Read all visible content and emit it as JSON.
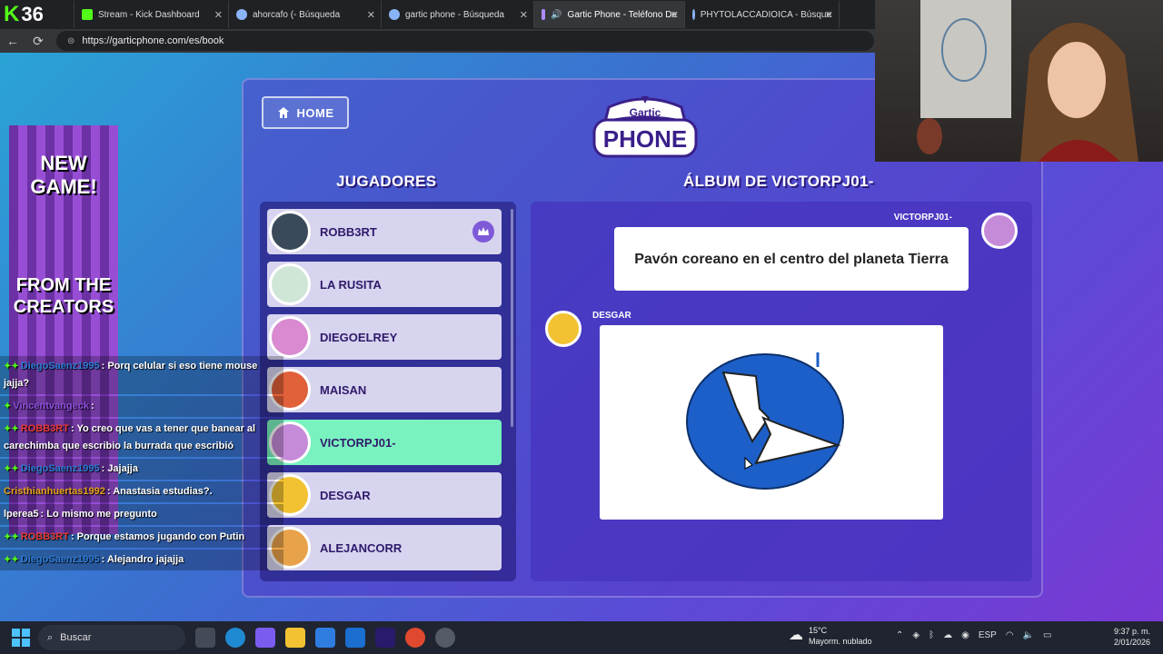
{
  "browser": {
    "kick_viewers": "36",
    "tabs": [
      {
        "label": "Stream - Kick Dashboard",
        "icon_color": "#53fc18"
      },
      {
        "label": "ahorcafo (- Búsqueda",
        "icon_color": "#8ab4f8"
      },
      {
        "label": "gartic phone - Búsqueda",
        "icon_color": "#8ab4f8"
      },
      {
        "label": "Gartic Phone - Teléfono De",
        "icon_color": "#b18cff"
      },
      {
        "label": "PHYTOLACCADIOICA - Búsque",
        "icon_color": "#8ab4f8"
      }
    ],
    "url": "https://garticphone.com/es/book"
  },
  "game": {
    "home_label": "HOME",
    "logo_top": "Gartic",
    "logo_bottom": "PHONE",
    "players_title": "JUGADORES",
    "album_title": "ÁLBUM DE VICTORPJ01-",
    "players": [
      {
        "name": "ROBB3RT",
        "avatar_color": "#3a4a5a",
        "host": true,
        "active": false
      },
      {
        "name": "LA RUSITA",
        "avatar_color": "#cfe6d6",
        "host": false,
        "active": false
      },
      {
        "name": "DIEGOELREY",
        "avatar_color": "#d98ad0",
        "host": false,
        "active": false
      },
      {
        "name": "MAISAN",
        "avatar_color": "#e0603a",
        "host": false,
        "active": false
      },
      {
        "name": "VICTORPJ01-",
        "avatar_color": "#c58ad8",
        "host": false,
        "active": true
      },
      {
        "name": "DESGAR",
        "avatar_color": "#f2c232",
        "host": false,
        "active": false
      },
      {
        "name": "ALEJANCORR",
        "avatar_color": "#e8a24a",
        "host": false,
        "active": false
      }
    ],
    "album": {
      "prompt_author": "VICTORPJ01-",
      "prompt_text": "Pavón coreano en el centro del planeta Tierra",
      "drawing_author": "DESGAR"
    }
  },
  "ad": {
    "line1": "NEW",
    "line2": "GAME!",
    "line3": "FROM THE",
    "line4": "CREATORS"
  },
  "chat": [
    {
      "user": "DiegoSaenz1995",
      "color": "#2e7bd6",
      "text": ": Porq celular si eso tiene mouse jajja?"
    },
    {
      "user": "Vincentvangeck",
      "color": "#8f4fe0",
      "text": ":"
    },
    {
      "user": "ROBB3RT",
      "color": "#e83a3a",
      "text": ": Yo creo que vas a tener que banear al carechimba que escribio la burrada que escribió"
    },
    {
      "user": "DiegoSaenz1995",
      "color": "#2e7bd6",
      "text": ": Jajajja"
    },
    {
      "user": "Cristhianhuertas1992",
      "color": "#e8a21a",
      "text": ": Anastasia estudias?."
    },
    {
      "user": "lperea5",
      "color": "#ffffff",
      "text": ": Lo mismo me pregunto"
    },
    {
      "user": "ROBB3RT",
      "color": "#e83a3a",
      "text": ": Porque estamos jugando con Putin"
    },
    {
      "user": "DiegoSaenz1995",
      "color": "#2e7bd6",
      "text": ": Alejandro jajajja"
    }
  ],
  "taskbar": {
    "search_label": "Buscar",
    "temp": "15°C",
    "weather": "Mayorm. nublado",
    "lang": "ESP",
    "time": "9:37 p. m.",
    "date": "2/01/2026"
  }
}
